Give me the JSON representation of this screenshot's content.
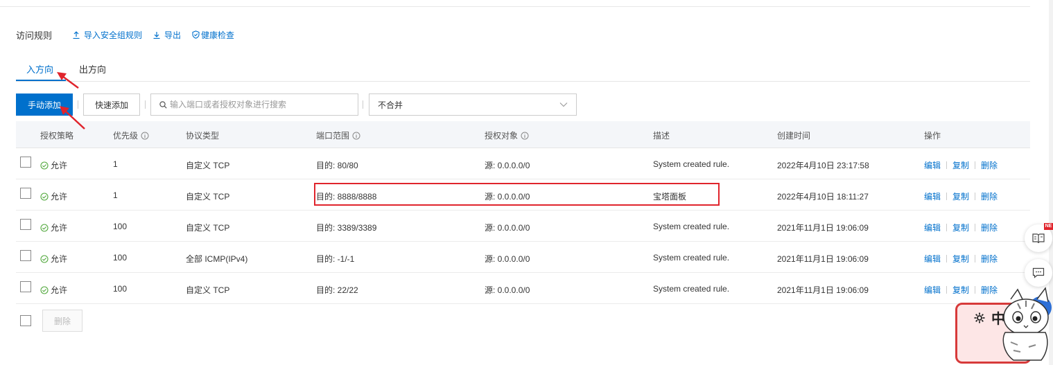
{
  "header": {
    "title": "访问规则",
    "links": [
      {
        "label": "导入安全组规则",
        "icon": "upload-icon"
      },
      {
        "label": "导出",
        "icon": "download-icon"
      },
      {
        "label": "健康检查",
        "icon": "shield-check-icon"
      }
    ]
  },
  "tabs": [
    {
      "label": "入方向",
      "active": true
    },
    {
      "label": "出方向",
      "active": false
    }
  ],
  "toolbar": {
    "manual_add_label": "手动添加",
    "quick_add_label": "快速添加",
    "search_placeholder": "输入端口或者授权对象进行搜索",
    "merge_select_value": "不合并"
  },
  "table": {
    "columns": [
      "授权策略",
      "优先级",
      "协议类型",
      "端口范围",
      "授权对象",
      "描述",
      "创建时间",
      "操作"
    ],
    "rows": [
      {
        "policy": "允许",
        "priority": "1",
        "protocol": "自定义 TCP",
        "port": "目的: 80/80",
        "source": "源: 0.0.0.0/0",
        "description": "System created rule.",
        "created": "2022年4月10日 23:17:58"
      },
      {
        "policy": "允许",
        "priority": "1",
        "protocol": "自定义 TCP",
        "port": "目的: 8888/8888",
        "source": "源: 0.0.0.0/0",
        "description": "宝塔面板",
        "created": "2022年4月10日 18:11:27"
      },
      {
        "policy": "允许",
        "priority": "100",
        "protocol": "自定义 TCP",
        "port": "目的: 3389/3389",
        "source": "源: 0.0.0.0/0",
        "description": "System created rule.",
        "created": "2021年11月1日 19:06:09"
      },
      {
        "policy": "允许",
        "priority": "100",
        "protocol": "全部 ICMP(IPv4)",
        "port": "目的: -1/-1",
        "source": "源: 0.0.0.0/0",
        "description": "System created rule.",
        "created": "2021年11月1日 19:06:09"
      },
      {
        "policy": "允许",
        "priority": "100",
        "protocol": "自定义 TCP",
        "port": "目的: 22/22",
        "source": "源: 0.0.0.0/0",
        "description": "System created rule.",
        "created": "2021年11月1日 19:06:09"
      }
    ],
    "row_actions": [
      "编辑",
      "复制",
      "删除"
    ]
  },
  "bottom": {
    "delete_label": "删除"
  },
  "side_widgets": {
    "new_badge": "NE",
    "mascot_text": "中"
  },
  "colors": {
    "accent": "#0070cc",
    "annotation": "#e0242c",
    "allow_green": "#52a83d"
  }
}
